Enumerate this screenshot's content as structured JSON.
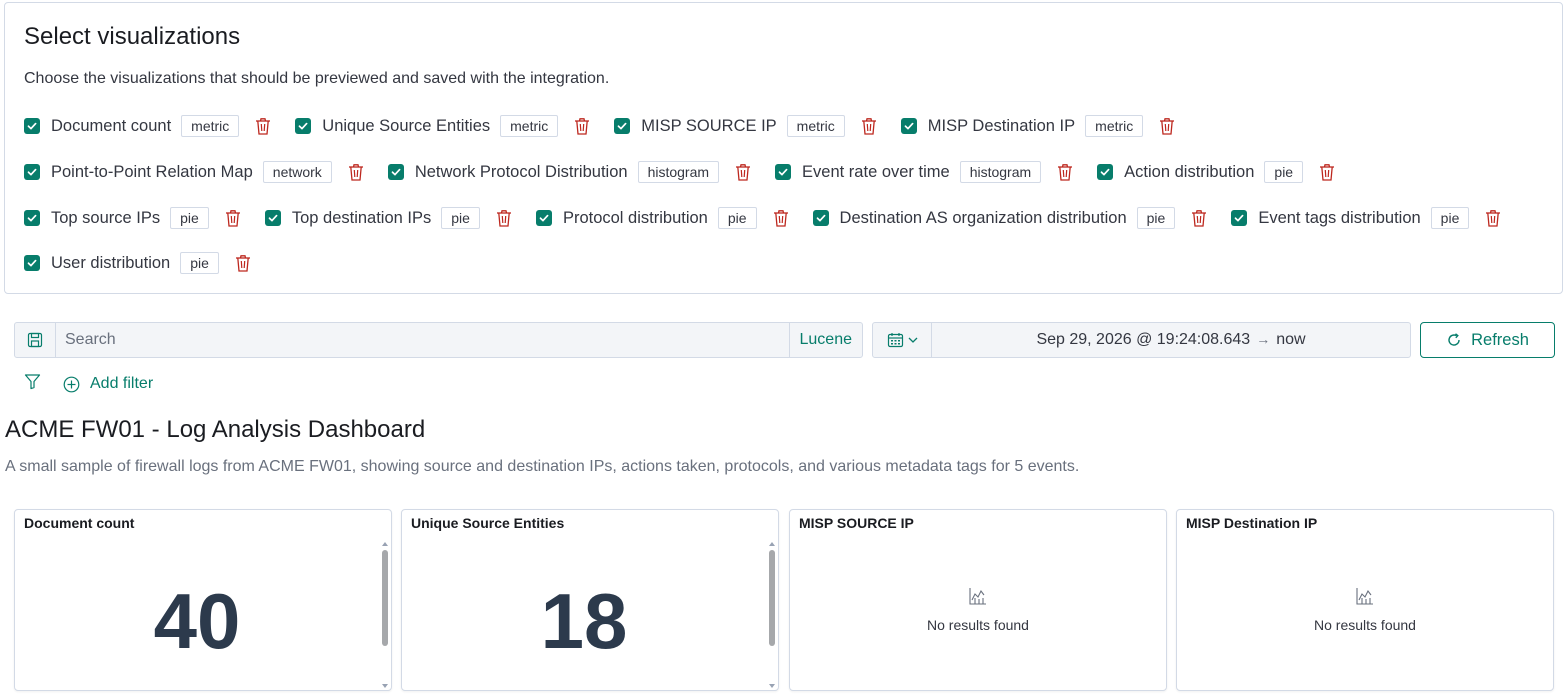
{
  "select_panel": {
    "title": "Select visualizations",
    "description": "Choose the visualizations that should be previewed and saved with the integration.",
    "rows": [
      [
        {
          "label": "Document count",
          "type": "metric"
        },
        {
          "label": "Unique Source Entities",
          "type": "metric"
        },
        {
          "label": "MISP SOURCE IP",
          "type": "metric"
        },
        {
          "label": "MISP Destination IP",
          "type": "metric"
        }
      ],
      [
        {
          "label": "Point-to-Point Relation Map",
          "type": "network"
        },
        {
          "label": "Network Protocol Distribution",
          "type": "histogram"
        },
        {
          "label": "Event rate over time",
          "type": "histogram"
        },
        {
          "label": "Action distribution",
          "type": "pie"
        }
      ],
      [
        {
          "label": "Top source IPs",
          "type": "pie"
        },
        {
          "label": "Top destination IPs",
          "type": "pie"
        },
        {
          "label": "Protocol distribution",
          "type": "pie"
        },
        {
          "label": "Destination AS organization distribution",
          "type": "pie"
        },
        {
          "label": "Event tags distribution",
          "type": "pie"
        }
      ],
      [
        {
          "label": "User distribution",
          "type": "pie"
        }
      ]
    ]
  },
  "query_bar": {
    "placeholder": "Search",
    "language": "Lucene",
    "date_start": "Sep 29, 2026 @ 19:24:08.643",
    "date_arrow": "→",
    "date_end": "now",
    "refresh_label": "Refresh"
  },
  "filters": {
    "add_filter_label": "Add filter"
  },
  "dashboard": {
    "title": "ACME FW01 - Log Analysis Dashboard",
    "description": "A small sample of firewall logs from ACME FW01, showing source and destination IPs, actions taken, protocols, and various metadata tags for 5 events.",
    "cards": [
      {
        "title": "Document count",
        "value": "40"
      },
      {
        "title": "Unique Source Entities",
        "value": "18"
      },
      {
        "title": "MISP SOURCE IP",
        "empty_text": "No results found"
      },
      {
        "title": "MISP Destination IP",
        "empty_text": "No results found"
      }
    ]
  },
  "colors": {
    "accent": "#077d6b",
    "danger": "#bd271e",
    "metric_text": "#2c3a4c",
    "border": "#d3dae6"
  },
  "icons": {
    "checkbox": "check-icon",
    "delete": "trash-icon",
    "save_query": "save-icon",
    "date_picker": "calendar-icon",
    "refresh": "refresh-icon",
    "filter": "filter-icon",
    "add_filter": "plus-circle-icon",
    "empty_chart": "chart-icon"
  }
}
